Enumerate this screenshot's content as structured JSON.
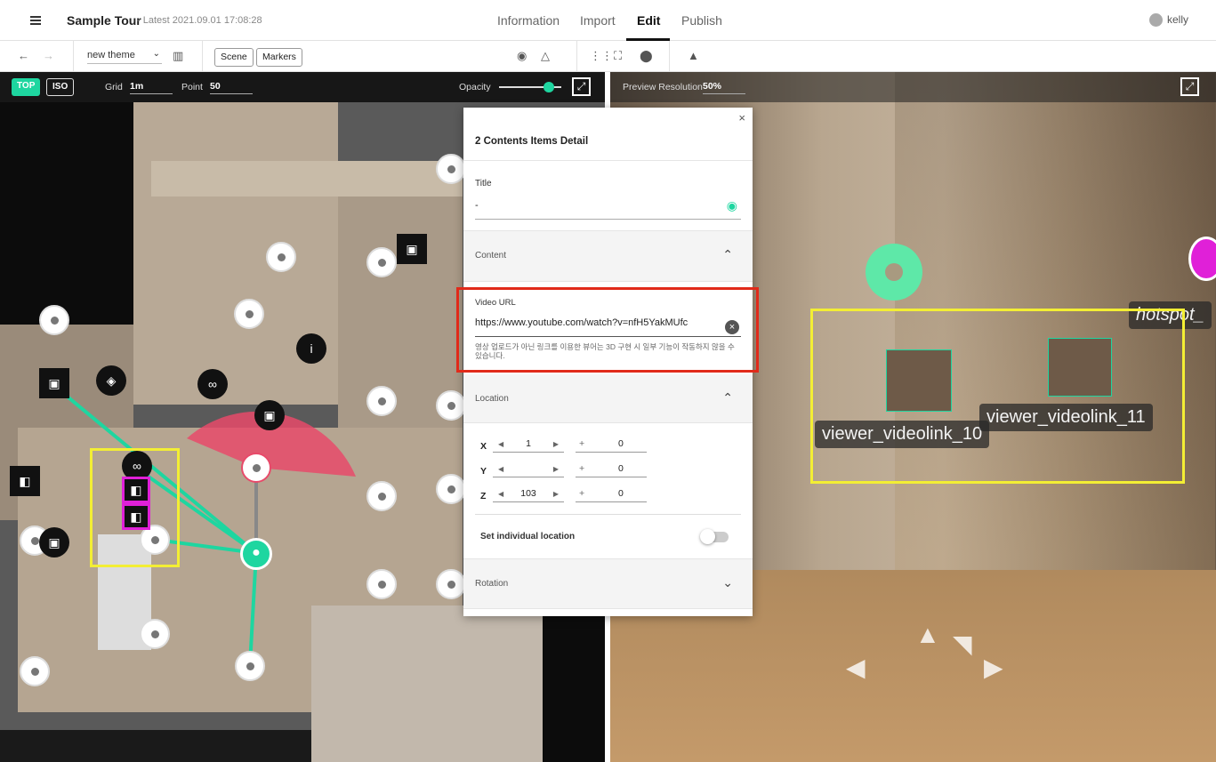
{
  "header": {
    "title": "Sample Tour",
    "subtitle": "- Latest 2021.09.01 17:08:28",
    "tabs": [
      "Information",
      "Import",
      "Edit",
      "Publish"
    ],
    "active_tab": "Edit",
    "user": "kelly"
  },
  "toolbar": {
    "theme": "new theme",
    "scene_button": "Scene",
    "markers_button": "Markers"
  },
  "map_header": {
    "view_top": "TOP",
    "view_iso": "ISO",
    "grid_label": "Grid",
    "grid_value": "1m",
    "point_label": "Point",
    "point_value": "50",
    "opacity_label": "Opacity",
    "opacity": 0.8
  },
  "preview_header": {
    "resolution_label": "Preview Resolution",
    "resolution_value": "50%"
  },
  "panel": {
    "heading": "2 Contents Items Detail",
    "title_label": "Title",
    "title_value": "-",
    "content_section": "Content",
    "video_url_label": "Video URL",
    "video_url_value": "https://www.youtube.com/watch?v=nfH5YakMUfc",
    "video_note": "영상 업로드가 아닌 링크를 이용한 뷰어는 3D 구현 시 일부 기능이 작동하지 않을 수 있습니다.",
    "location_section": "Location",
    "x_label": "X",
    "x_value": "1",
    "x_offset": "0",
    "y_label": "Y",
    "y_value": "",
    "y_offset": "0",
    "z_label": "Z",
    "z_value": "103",
    "z_offset": "0",
    "plus": "+",
    "individual_location": "Set individual location",
    "rotation_section": "Rotation"
  },
  "viewer": {
    "label_10": "viewer_videolink_10",
    "label_11": "viewer_videolink_11",
    "hotspot_label": "hotspot_"
  },
  "colors": {
    "accent": "#1ed6a0",
    "highlight_red": "#e12a1a",
    "yellow": "#f3ee34",
    "magenta": "#e020d8",
    "fov_pink": "#e84a6a"
  }
}
